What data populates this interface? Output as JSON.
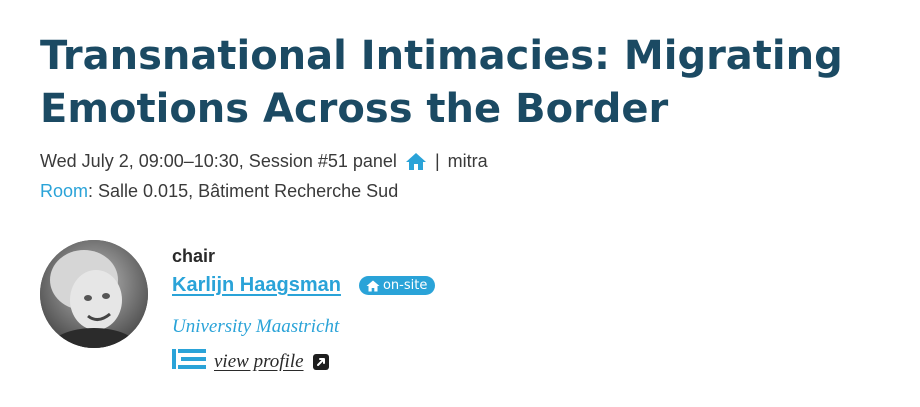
{
  "session": {
    "title": "Transnational Intimacies: Migrating Emotions Across the Border",
    "datetime": "Wed July 2, 09:00–10:30, Session #51 panel",
    "separator": "|",
    "tag": "mitra",
    "room_label": "Room",
    "room_value": ": Salle 0.015, Bâtiment Recherche Sud",
    "icon": "home-icon"
  },
  "chair": {
    "role": "chair",
    "name": "Karlijn Haagsman",
    "badge": "on-site",
    "affiliation": "University Maastricht",
    "profile_link": "view profile",
    "icons": [
      "profile-list-icon",
      "external-link-icon",
      "home-icon"
    ]
  },
  "colors": {
    "title": "#1b4a63",
    "accent": "#2aa3d8",
    "text": "#3a3a3a"
  }
}
